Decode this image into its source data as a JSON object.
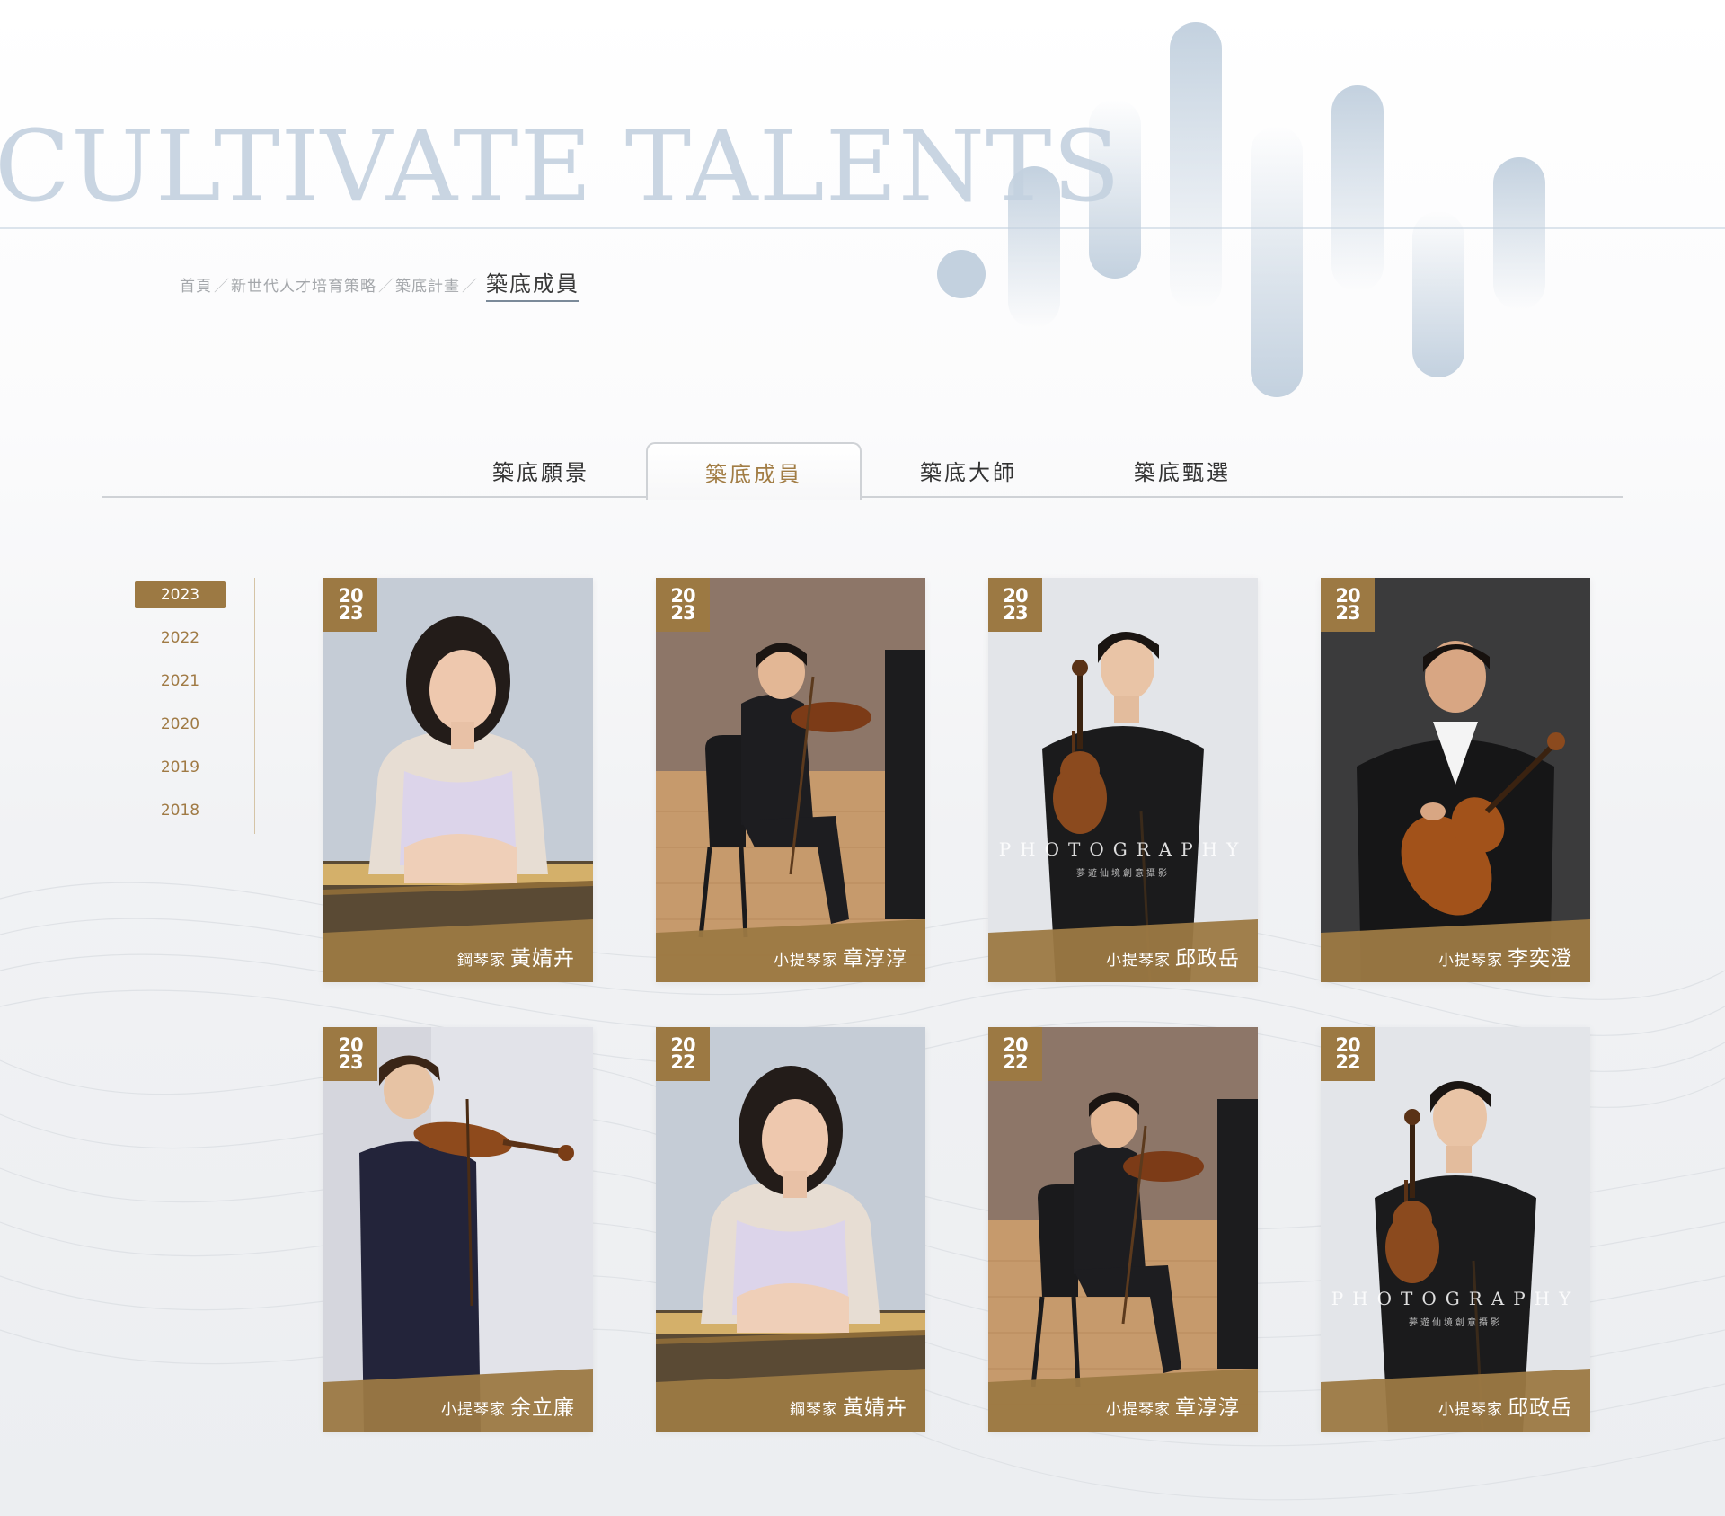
{
  "hero": {
    "title": "CULTIVATE TALENTS"
  },
  "breadcrumb": {
    "items": [
      "首頁",
      "新世代人才培育策略",
      "築底計畫"
    ],
    "separator": "／",
    "current": "築底成員"
  },
  "tabs": [
    {
      "label": "築底願景",
      "active": false
    },
    {
      "label": "築底成員",
      "active": true
    },
    {
      "label": "築底大師",
      "active": false
    },
    {
      "label": "築底甄選",
      "active": false
    }
  ],
  "years": [
    {
      "label": "2023",
      "active": true
    },
    {
      "label": "2022",
      "active": false
    },
    {
      "label": "2021",
      "active": false
    },
    {
      "label": "2020",
      "active": false
    },
    {
      "label": "2019",
      "active": false
    },
    {
      "label": "2018",
      "active": false
    }
  ],
  "cards": [
    {
      "year_top": "20",
      "year_bottom": "23",
      "role": "鋼琴家",
      "name": "黃婧卉",
      "photo": "pianist-portrait"
    },
    {
      "year_top": "20",
      "year_bottom": "23",
      "role": "小提琴家",
      "name": "章淳淳",
      "photo": "violinist-stage"
    },
    {
      "year_top": "20",
      "year_bottom": "23",
      "role": "小提琴家",
      "name": "邱政岳",
      "photo": "violinist-standing",
      "watermark": "PHOTOGRAPHY",
      "watermark_sub": "夢遊仙境創意攝影"
    },
    {
      "year_top": "20",
      "year_bottom": "23",
      "role": "小提琴家",
      "name": "李奕澄",
      "photo": "violinist-dark"
    },
    {
      "year_top": "20",
      "year_bottom": "23",
      "role": "小提琴家",
      "name": "余立廉",
      "photo": "violinist-playing"
    },
    {
      "year_top": "20",
      "year_bottom": "22",
      "role": "鋼琴家",
      "name": "黃婧卉",
      "photo": "pianist-portrait"
    },
    {
      "year_top": "20",
      "year_bottom": "22",
      "role": "小提琴家",
      "name": "章淳淳",
      "photo": "violinist-stage"
    },
    {
      "year_top": "20",
      "year_bottom": "22",
      "role": "小提琴家",
      "name": "邱政岳",
      "photo": "violinist-standing",
      "watermark": "PHOTOGRAPHY",
      "watermark_sub": "夢遊仙境創意攝影"
    }
  ],
  "colors": {
    "accent_gold": "#9c7943",
    "tab_active_text": "#a27d45",
    "hero_text": "#c9d5e2",
    "equalizer_bar": "#c3d1df"
  }
}
